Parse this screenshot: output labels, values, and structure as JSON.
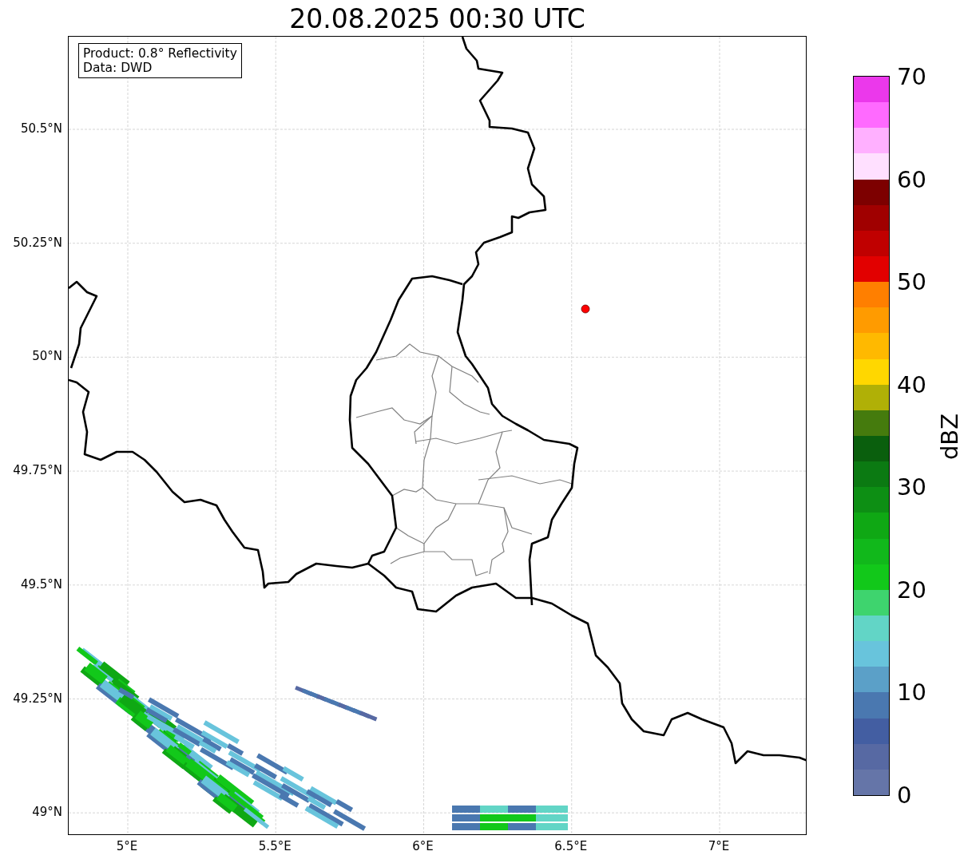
{
  "title": "20.08.2025 00:30 UTC",
  "legend": {
    "lines": [
      "Product: 0.8° Reflectivity",
      "Data: DWD"
    ]
  },
  "map": {
    "y_axis_labels": [
      "50.5°N",
      "50.25°N",
      "50°N",
      "49.75°N",
      "49.5°N",
      "49.25°N",
      "49°N"
    ],
    "x_axis_labels": [
      "5°E",
      "5.5°E",
      "6°E",
      "6.5°E",
      "7°E"
    ]
  },
  "colorbar": {
    "label": "dBZ",
    "ticks": [
      "70",
      "60",
      "50",
      "40",
      "30",
      "20",
      "10",
      "0"
    ],
    "bins": [
      {
        "color": "#6575a8"
      },
      {
        "color": "#5769a3"
      },
      {
        "color": "#435ea2"
      },
      {
        "color": "#4a78b0"
      },
      {
        "color": "#5ba0c8"
      },
      {
        "color": "#68c4dc"
      },
      {
        "color": "#62d5c6"
      },
      {
        "color": "#3ed46e"
      },
      {
        "color": "#12c81a"
      },
      {
        "color": "#11b81b"
      },
      {
        "color": "#0fa814"
      },
      {
        "color": "#0d8f14"
      },
      {
        "color": "#0b7a12"
      },
      {
        "color": "#0a5f0d"
      },
      {
        "color": "#457b0d"
      },
      {
        "color": "#b0b006"
      },
      {
        "color": "#ffd700"
      },
      {
        "color": "#ffb900"
      },
      {
        "color": "#ff9b00"
      },
      {
        "color": "#ff7f00"
      },
      {
        "color": "#e20000"
      },
      {
        "color": "#c00000"
      },
      {
        "color": "#a00000"
      },
      {
        "color": "#7d0000"
      },
      {
        "color": "#ffe0ff"
      },
      {
        "color": "#ffb0ff"
      },
      {
        "color": "#ff6aff"
      },
      {
        "color": "#eb38eb"
      }
    ]
  }
}
